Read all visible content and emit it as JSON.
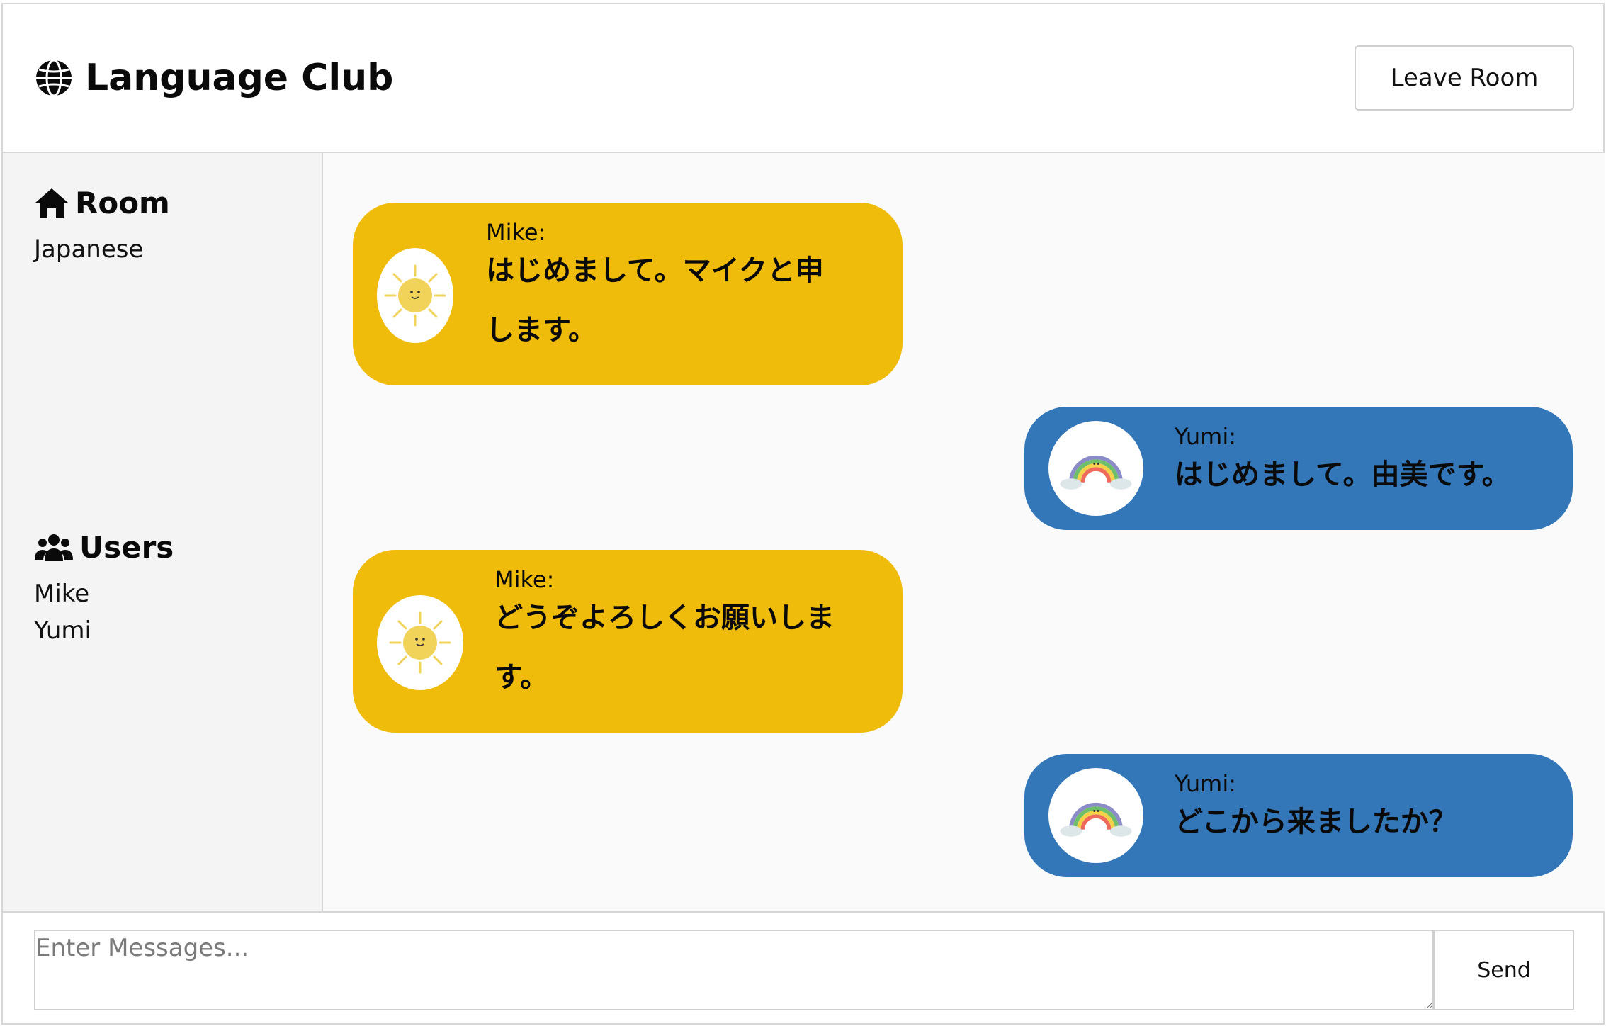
{
  "header": {
    "title": "Language Club",
    "leave_label": "Leave Room",
    "logo_icon": "globe-icon"
  },
  "sidebar": {
    "room_heading": "Room",
    "room_icon": "home-icon",
    "room_name": "Japanese",
    "users_heading": "Users",
    "users_icon": "users-icon",
    "users": [
      "Mike",
      "Yumi"
    ]
  },
  "messages": [
    {
      "sender": "Mike:",
      "avatar": "sun-avatar-icon",
      "line1": "はじめまして。マイクと申",
      "line2": "します。"
    },
    {
      "sender": "Yumi:",
      "avatar": "rainbow-avatar-icon",
      "line1": "はじめまして。由美です。"
    },
    {
      "sender": "Mike:",
      "avatar": "sun-avatar-icon",
      "line1": "どうぞよろしくお願いしま",
      "line2": "す。"
    },
    {
      "sender": "Yumi:",
      "avatar": "rainbow-avatar-icon",
      "line1": "どこから来ましたか？"
    }
  ],
  "composer": {
    "placeholder": "Enter Messages...",
    "send_label": "Send"
  },
  "colors": {
    "mike_bubble": "#f0bc0c",
    "yumi_bubble": "#3477b8",
    "sidebar_bg": "#f4f4f4",
    "chat_bg": "#fafafa"
  }
}
